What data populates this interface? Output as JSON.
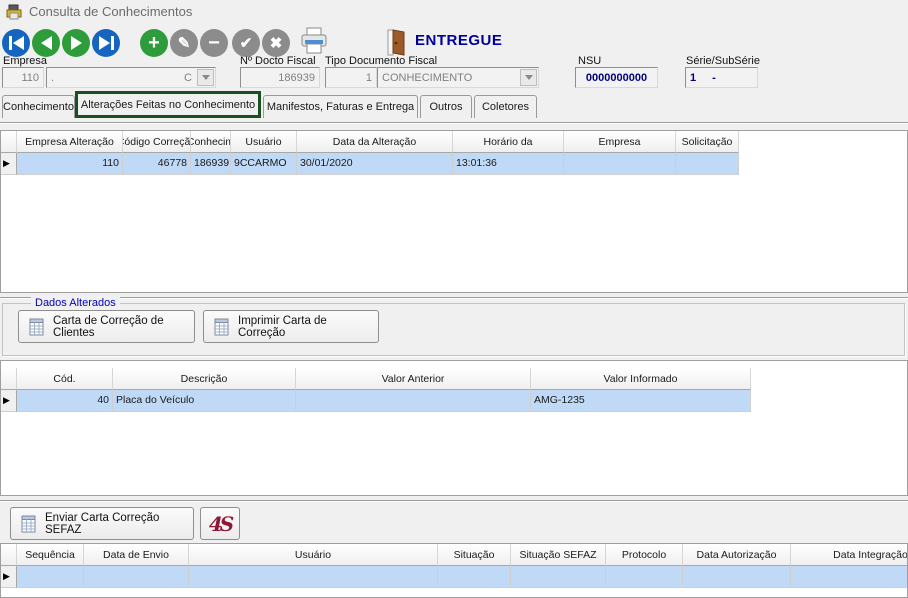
{
  "window": {
    "title": "Consulta de Conhecimentos"
  },
  "toolbar": {
    "status_label": "ENTREGUE"
  },
  "fields": {
    "empresa": {
      "label": "Empresa",
      "code": "110",
      "combo_left": ".",
      "combo_right": "C"
    },
    "docto": {
      "label": "Nº Docto Fiscal",
      "value": "186939"
    },
    "tipo": {
      "label": "Tipo Documento Fiscal",
      "code": "1",
      "name": "CONHECIMENTO"
    },
    "nsu": {
      "label": "NSU",
      "value": "0000000000"
    },
    "serie": {
      "label": "Série/SubSérie",
      "serie": "1",
      "separator": "-"
    }
  },
  "tabs": [
    {
      "label": "Conhecimento",
      "active": false
    },
    {
      "label": "Alterações Feitas no Conhecimento",
      "active": true
    },
    {
      "label": "Manifestos, Faturas e Entrega",
      "active": false
    },
    {
      "label": "Outros",
      "active": false
    },
    {
      "label": "Coletores",
      "active": false
    }
  ],
  "grids": {
    "alteracoes": {
      "columns": [
        "Empresa Alteração",
        "Código Correção",
        "Conhecim",
        "Usuário",
        "Data da Alteração",
        "Horário da",
        "Empresa",
        "Solicitação"
      ],
      "rows": [
        [
          "110",
          "46778",
          "186939",
          "9CCARMO",
          "30/01/2020",
          "13:01:36",
          "",
          ""
        ]
      ]
    },
    "dados": {
      "columns": [
        "Cód.",
        "Descrição",
        "Valor Anterior",
        "Valor Informado"
      ],
      "rows": [
        [
          "40",
          "Placa do Veículo",
          "",
          "AMG-1235"
        ]
      ]
    },
    "envios": {
      "columns": [
        "Sequência",
        "Data de Envio",
        "Usuário",
        "Situação",
        "Situação SEFAZ",
        "Protocolo",
        "Data Autorização",
        "Data Integração"
      ],
      "rows": [
        [
          "",
          "",
          "",
          "",
          "",
          "",
          "",
          ""
        ]
      ]
    }
  },
  "dados_alterados": {
    "title": "Dados Alterados",
    "clientes_button": "Carta de Correção de Clientes",
    "imprimir_button": "Imprimir Carta de Correção"
  },
  "sefaz": {
    "enviar_button": "Enviar Carta Correção SEFAZ",
    "logo_glyph": "4S"
  },
  "colors": {
    "status_navy": "#000099",
    "active_tab_green": "#1a4f1f",
    "selected_row_blue": "#bfd9f7",
    "logo_maroon": "#8e1838",
    "nav_blue": "#1565c0",
    "action_green": "#2e9c3a",
    "disabled_gray": "#8c8c8c",
    "groupbox_label_blue": "#0000c0"
  }
}
